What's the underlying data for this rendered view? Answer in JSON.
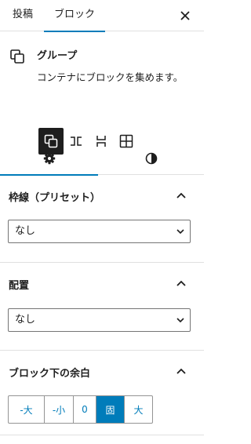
{
  "tabs": {
    "post": "投稿",
    "block": "ブロック",
    "close": "×"
  },
  "block_card": {
    "title": "グループ",
    "description": "コンテナにブロックを集めます。"
  },
  "variations": [
    "group",
    "row",
    "stack",
    "grid"
  ],
  "subtabs": {
    "settings_icon": "gear-icon",
    "styles_icon": "half-circle-icon"
  },
  "border_preset": {
    "title": "枠線（プリセット）",
    "value": "なし"
  },
  "alignment": {
    "title": "配置",
    "value": "なし"
  },
  "bottom_margin": {
    "title": "ブロック下の余白",
    "options": [
      "-大",
      "-小",
      "0",
      "固",
      "大"
    ],
    "selected": "固"
  },
  "colors": {
    "accent": "#007cba",
    "text": "#1e1e1e",
    "border": "#e0e0e0"
  }
}
